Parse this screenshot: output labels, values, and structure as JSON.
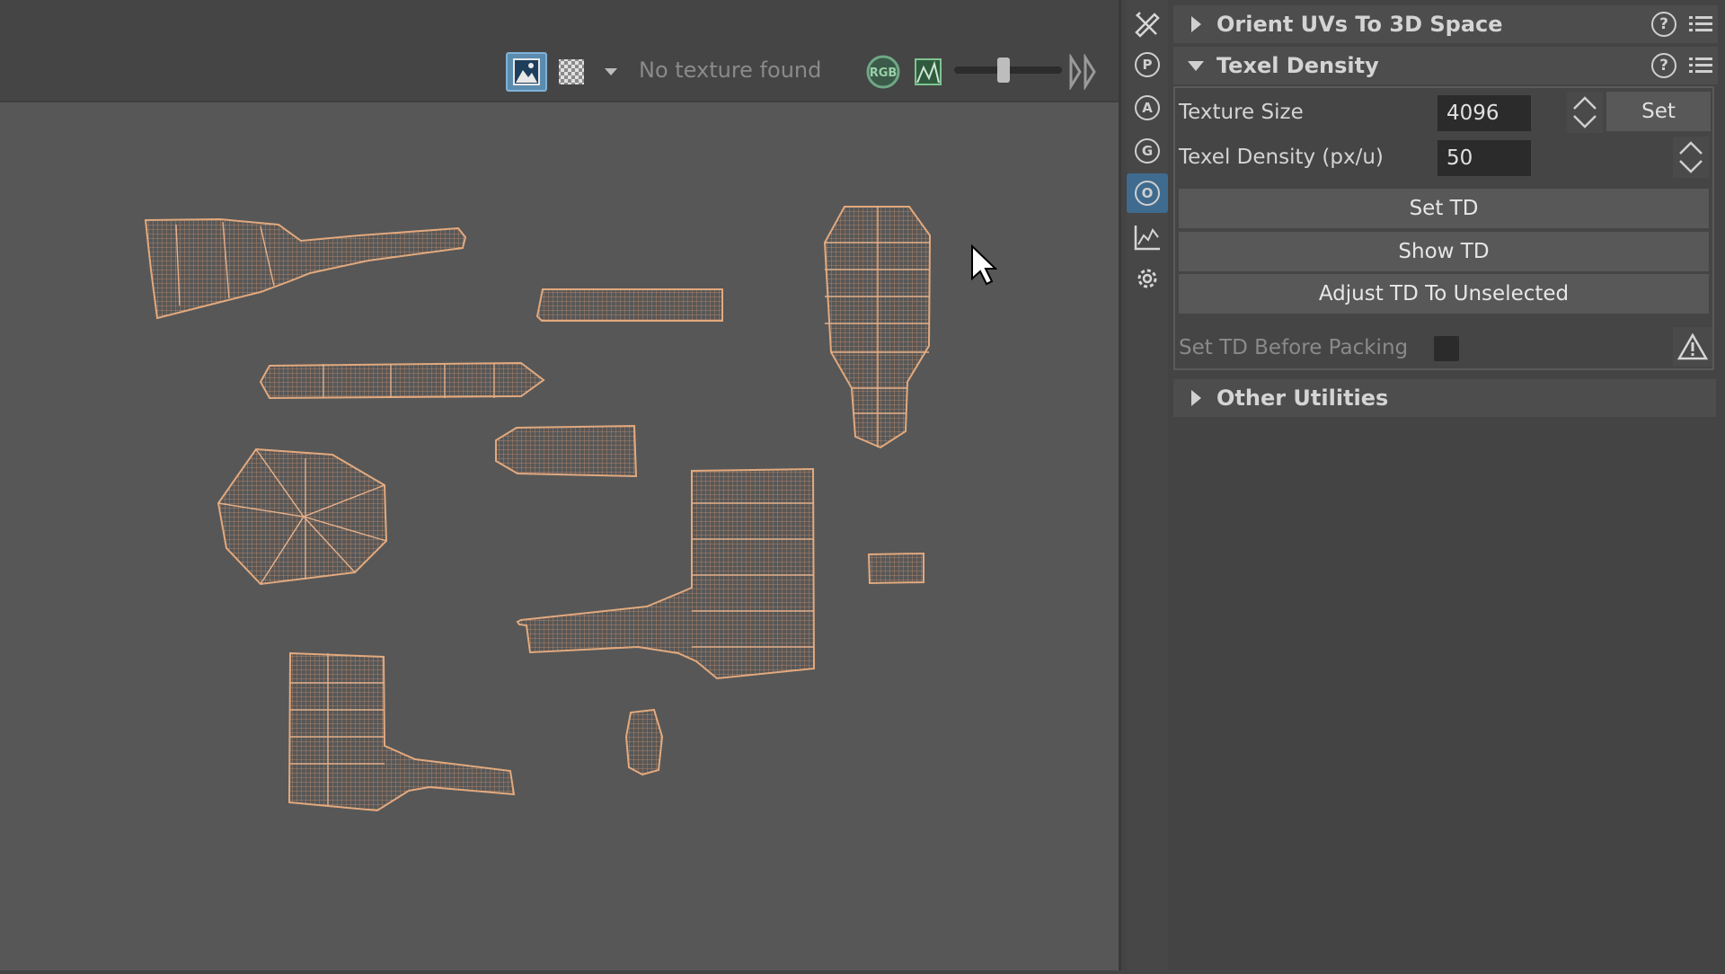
{
  "toolbar": {
    "texture_label": "No texture found",
    "rgb_label": "RGB",
    "buttons": [
      "image-view",
      "checker",
      "checker-dropdown",
      "rgb-channel",
      "texture-display"
    ],
    "slider_level": 0.4
  },
  "icons": {
    "side": [
      "tools-icon",
      "p-circle-icon",
      "a-circle-icon",
      "g-circle-icon",
      "o-circle-icon",
      "chart-icon",
      "gear-icon"
    ],
    "side_letters": {
      "p": "P",
      "a": "A",
      "g": "G",
      "o": "O"
    },
    "active_side": "o-circle-icon"
  },
  "panel": {
    "orient": {
      "title": "Orient UVs To 3D Space",
      "expanded": false
    },
    "texel_density": {
      "title": "Texel Density",
      "expanded": true,
      "texture_size_label": "Texture Size",
      "texture_size_value": "4096",
      "set_label": "Set",
      "density_label": "Texel Density (px/u)",
      "density_value": "50",
      "set_td_label": "Set TD",
      "show_td_label": "Show TD",
      "adjust_label": "Adjust TD To Unselected",
      "before_packing_label": "Set TD Before Packing",
      "before_packing_checked": false
    },
    "other": {
      "title": "Other Utilities",
      "expanded": false
    },
    "help_glyph": "?"
  },
  "colors": {
    "uv_wire": "#e2a97e",
    "uv_fill": "#c08a6a",
    "active_blue": "#5b8cb0",
    "panel_bg": "#444444",
    "canvas_bg": "#575757"
  }
}
